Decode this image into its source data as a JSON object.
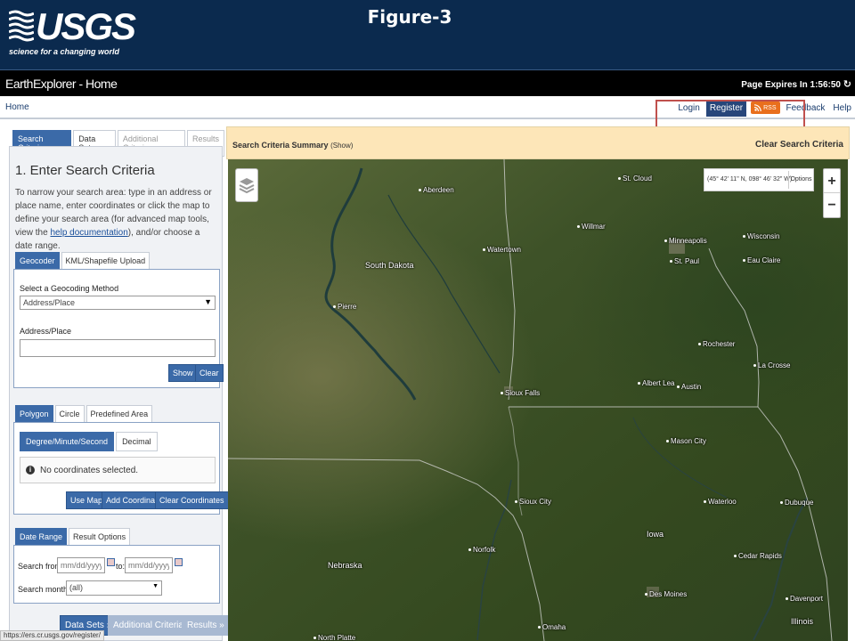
{
  "header": {
    "logo_text": "USGS",
    "logo_tagline": "science for a changing world",
    "figure_title": "Figure-3"
  },
  "topbar": {
    "app_title": "EarthExplorer - Home",
    "page_expires": "Page Expires In 1:56:50"
  },
  "nav": {
    "home": "Home",
    "login": "Login",
    "register": "Register",
    "rss": "RSS",
    "feedback": "Feedback",
    "help": "Help"
  },
  "left": {
    "tabs": [
      "Search Criteria",
      "Data Sets",
      "Additional Criteria",
      "Results"
    ],
    "step_title": "1. Enter Search Criteria",
    "desc_before_link": "To narrow your search area: type in an address or place name, enter coordinates or click the map to define your search area (for advanced map tools, view the ",
    "desc_link": "help documentation",
    "desc_after_link": "), and/or choose a date range.",
    "geo_tabs": [
      "Geocoder",
      "KML/Shapefile Upload"
    ],
    "geocoding_method_label": "Select a Geocoding Method",
    "geocoding_method_value": "Address/Place",
    "address_label": "Address/Place",
    "address_value": "",
    "show_btn": "Show",
    "clear_btn": "Clear",
    "shape_tabs": [
      "Polygon",
      "Circle",
      "Predefined Area"
    ],
    "coord_tabs": [
      "Degree/Minute/Second",
      "Decimal"
    ],
    "no_coords": "No coordinates selected.",
    "use_map_btn": "Use Map",
    "add_coord_btn": "Add Coordinate",
    "clear_coords_btn": "Clear Coordinates",
    "date_tabs": [
      "Date Range",
      "Result Options"
    ],
    "search_from_label": "Search from:",
    "date_from_placeholder": "mm/dd/yyyy",
    "to_label": "to:",
    "date_to_placeholder": "mm/dd/yyyy",
    "months_label": "Search months:",
    "months_value": "(all)",
    "bottom_buttons": [
      "Data Sets »",
      "Additional Criteria »",
      "Results »"
    ]
  },
  "summary": {
    "title": "Search Criteria Summary",
    "show": "(Show)",
    "clear": "Clear Search Criteria"
  },
  "map": {
    "coords": "(45° 42' 11\" N, 098° 46' 32\" W)",
    "options": "Options",
    "zoom_in": "+",
    "zoom_out": "−",
    "cities": {
      "aberdeen": "Aberdeen",
      "st_cloud": "St. Cloud",
      "willmar": "Willmar",
      "watertown": "Watertown",
      "minneapolis": "Minneapolis",
      "st_paul": "St. Paul",
      "wisconsin": "Wisconsin",
      "eau_claire": "Eau Claire",
      "pierre": "Pierre",
      "rochester": "Rochester",
      "la_crosse": "La Crosse",
      "albert_lea": "Albert Lea",
      "austin": "Austin",
      "sioux_falls": "Sioux Falls",
      "mason_city": "Mason City",
      "sioux_city": "Sioux City",
      "waterloo": "Waterloo",
      "dubuque": "Dubuque",
      "norfolk": "Norfolk",
      "cedar_rapids": "Cedar Rapids",
      "des_moines": "Des Moines",
      "davenport": "Davenport",
      "illinois": "Illinois",
      "omaha": "Omaha",
      "north_platte": "North Platte"
    },
    "regions": {
      "south_dakota": "South Dakota",
      "iowa": "Iowa",
      "nebraska": "Nebraska"
    }
  },
  "status_url": "https://ers.cr.usgs.gov/register/",
  "colors": {
    "banner": "#0b2a4e",
    "accent": "#3b6aa8",
    "summary_bg": "#fde6b8",
    "rss": "#e96f1d",
    "highlight": "#c0504d"
  }
}
